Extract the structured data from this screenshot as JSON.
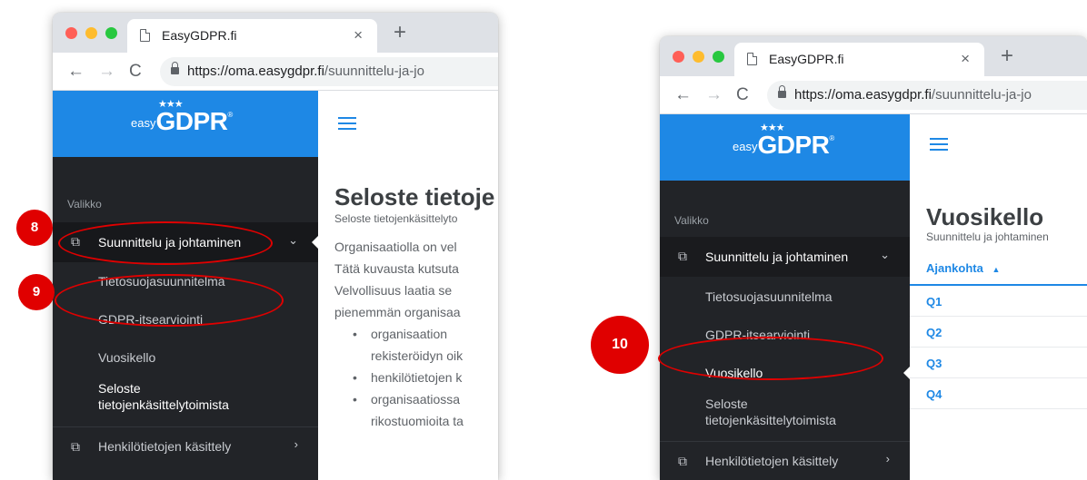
{
  "browser": {
    "tab_title": "EasyGDPR.fi",
    "tab_close": "×",
    "new_tab": "+",
    "url_host": "https://oma.easygdpr.fi",
    "url_path": "/suunnittelu-ja-jo"
  },
  "brand": {
    "easy": "easy",
    "gdpr": "GDPR",
    "stars": "★★★",
    "reg": "®",
    "color": "#1e88e5"
  },
  "sidebar": {
    "menu_title": "Valikko",
    "section1": "Suunnittelu ja johtaminen",
    "items": [
      "Tietosuojasuunnitelma",
      "GDPR-itsearviointi",
      "Vuosikello",
      "Seloste",
      "tietojenkäsittelytoimista"
    ],
    "section2": "Henkilötietojen käsittely",
    "section_icon": "documents-icon",
    "chevron_down": "⌄",
    "chevron_right": "›"
  },
  "window1": {
    "title": "Seloste tietoje",
    "subtitle": "Seloste tietojenkäsittelyto",
    "paragraph": [
      "Organisaatiolla on vel",
      "Tätä kuvausta kutsuta",
      "Velvollisuus laatia se",
      "pienemmän organisaa"
    ],
    "bullets": [
      {
        "text": "organisaation",
        "cont": "rekisteröidyn oik"
      },
      {
        "text": "henkilötietojen k",
        "cont": ""
      },
      {
        "text": "organisaatiossa",
        "cont": "rikostuomioita ta"
      }
    ]
  },
  "window2": {
    "title": "Vuosikello",
    "subtitle": "Suunnittelu ja johtaminen",
    "column_header": "Ajankohta",
    "sort_icon": "▲",
    "rows": [
      "Q1",
      "Q2",
      "Q3",
      "Q4"
    ]
  },
  "annotations": {
    "badge_8": "8",
    "badge_9": "9",
    "badge_10": "10",
    "color": "#e00000"
  }
}
